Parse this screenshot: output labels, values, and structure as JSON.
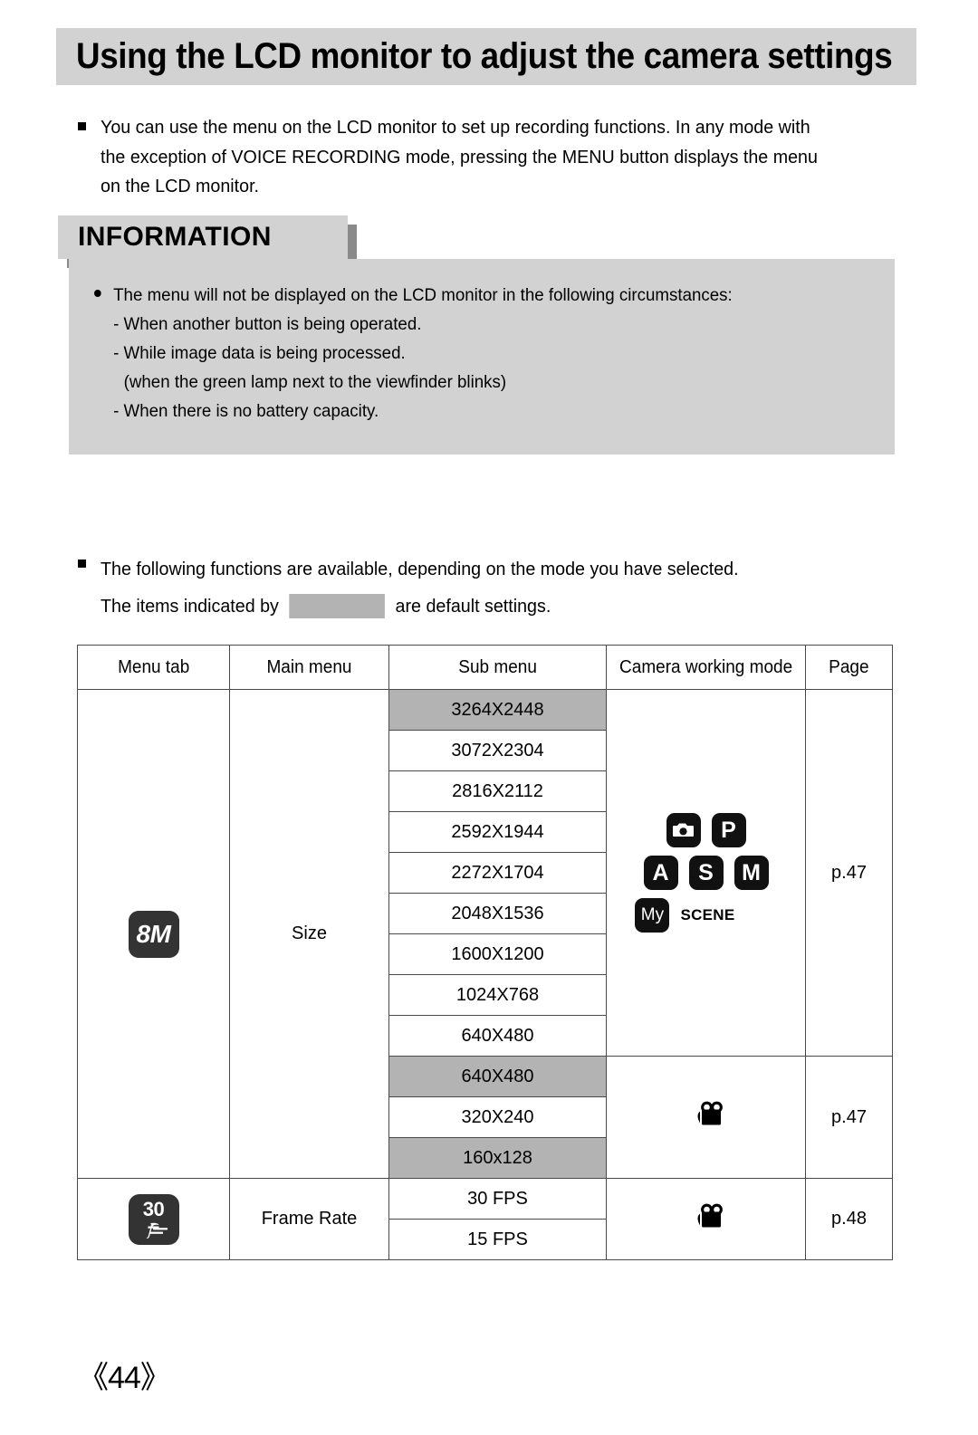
{
  "page": {
    "title": "Using the LCD monitor to adjust the camera settings",
    "page_number": "《44》"
  },
  "intro": {
    "line1": "You can use the menu on the LCD monitor to set up recording functions. In any mode with",
    "line2": "the exception of VOICE RECORDING mode, pressing the MENU button displays the menu",
    "line3": "on the LCD monitor."
  },
  "information": {
    "heading": "INFORMATION",
    "lead": "The menu will not be displayed on the LCD monitor in the following circumstances:",
    "items": [
      "- When another button is being operated.",
      "- While image data is being processed.",
      "(when the green lamp next to the viewfinder blinks)",
      "- When there is no battery capacity."
    ]
  },
  "second_note": {
    "line1": "The following functions are available, depending on the mode you have selected.",
    "line2_before": "The items indicated by",
    "line2_after": "are default settings.",
    "swatch_color": "#b3b3b3"
  },
  "table": {
    "headers": {
      "menu_tab": "Menu tab",
      "main_menu": "Main menu",
      "sub_menu": "Sub menu",
      "camera_working_mode": "Camera working mode",
      "page": "Page"
    },
    "groups": [
      {
        "menu_tab_icon": "8m-icon",
        "menu_tab_icon_label": "8M",
        "main_menu": "Size",
        "sub_menus": [
          {
            "label": "3264X2448",
            "default": true
          },
          {
            "label": "3072X2304",
            "default": false
          },
          {
            "label": "2816X2112",
            "default": false
          },
          {
            "label": "2592X1944",
            "default": false
          },
          {
            "label": "2272X1704",
            "default": false
          },
          {
            "label": "2048X1536",
            "default": false
          },
          {
            "label": "1600X1200",
            "default": false
          },
          {
            "label": "1024X768",
            "default": false
          },
          {
            "label": "640X480",
            "default": false
          }
        ],
        "modes": [
          [
            "camera-icon",
            "P"
          ],
          [
            "A",
            "S",
            "M"
          ],
          [
            "My",
            "SCENE"
          ]
        ],
        "page": "p.47"
      },
      {
        "main_menu": "",
        "sub_menus": [
          {
            "label": "640X480",
            "default": true
          },
          {
            "label": "320X240",
            "default": false
          },
          {
            "label": "160x128",
            "default": true
          }
        ],
        "modes": [
          [
            "movie-camera-icon"
          ]
        ],
        "page": "p.47"
      },
      {
        "menu_tab_icon": "frame-rate-icon",
        "menu_tab_icon_label": "30",
        "main_menu": "Frame Rate",
        "sub_menus": [
          {
            "label": "30 FPS",
            "default": false
          },
          {
            "label": "15 FPS",
            "default": false
          }
        ],
        "modes": [
          [
            "movie-camera-icon"
          ]
        ],
        "page": "p.48"
      }
    ]
  }
}
